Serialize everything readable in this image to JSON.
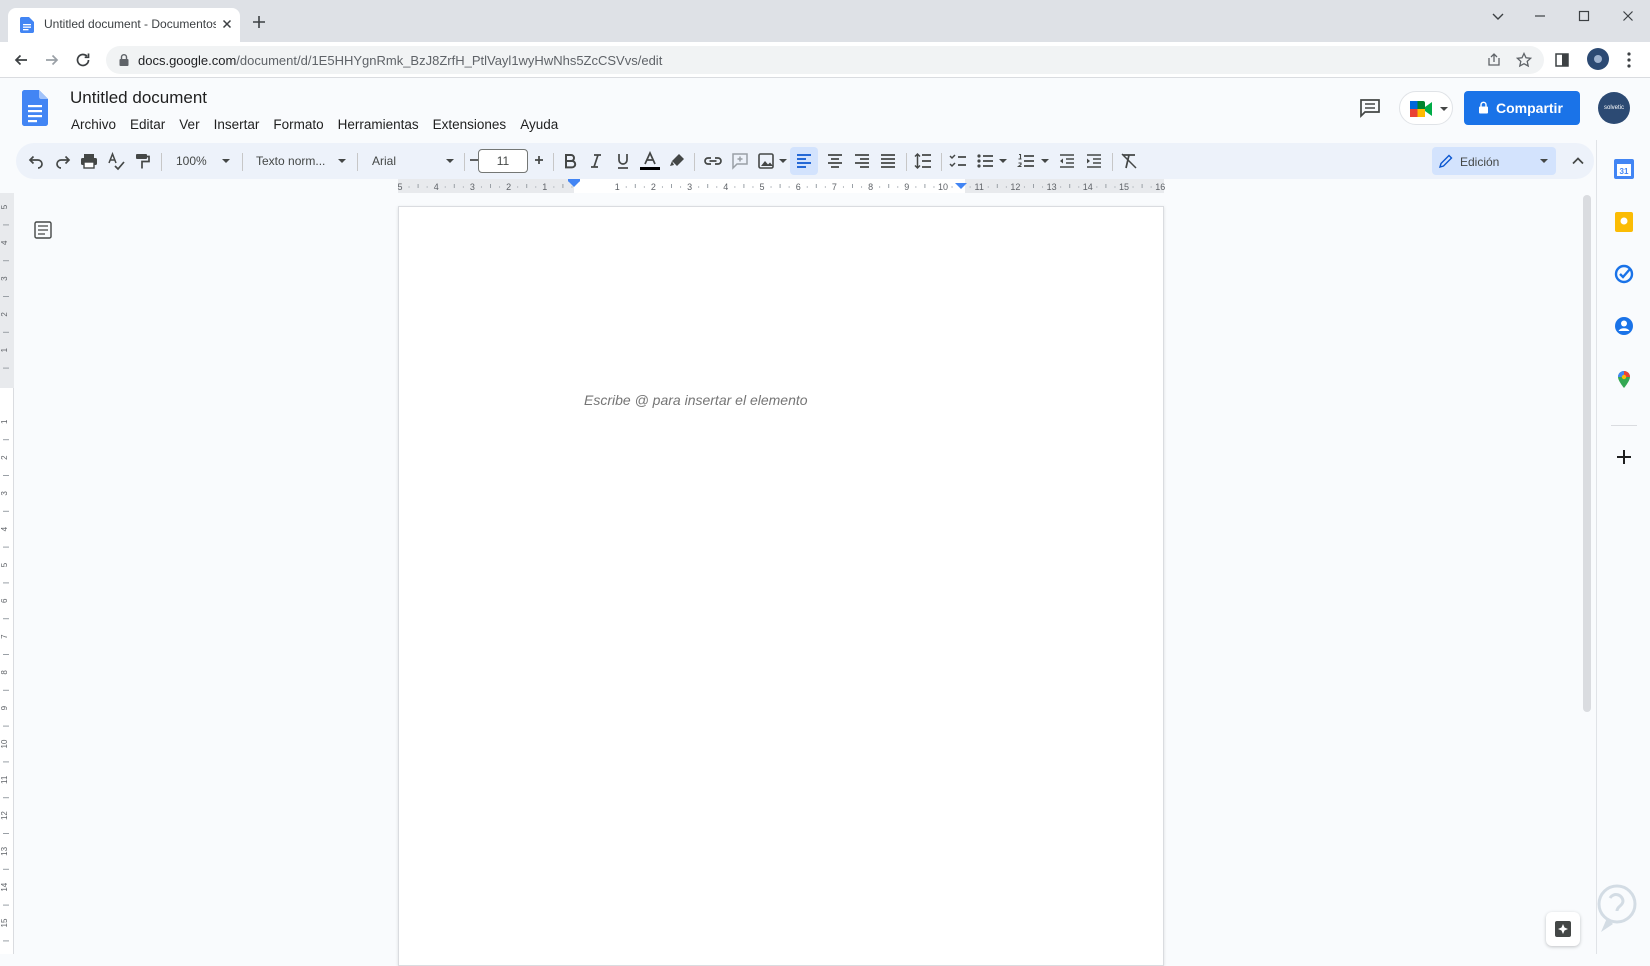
{
  "browser": {
    "tab_title": "Untitled document - Documentos",
    "url_host": "docs.google.com",
    "url_path": "/document/d/1E5HHYgnRmk_BzJ8ZrfH_PtlVayl1wyHwNhs5ZcCSVvs/edit"
  },
  "doc": {
    "title": "Untitled document",
    "menu": [
      "Archivo",
      "Editar",
      "Ver",
      "Insertar",
      "Formato",
      "Herramientas",
      "Extensiones",
      "Ayuda"
    ],
    "share_label": "Compartir",
    "avatar_text": "solvetic"
  },
  "toolbar": {
    "zoom": "100%",
    "style": "Texto norm...",
    "font": "Arial",
    "font_size": "11",
    "mode": "Edición"
  },
  "ruler": {
    "labels": [
      "5",
      "4",
      "3",
      "2",
      "1",
      "1",
      "1",
      "2",
      "3",
      "4",
      "5",
      "6",
      "7",
      "8",
      "9",
      "10",
      "11",
      "12",
      "13",
      "14",
      "15",
      "16"
    ],
    "vertical_labels": [
      "5",
      "4",
      "3",
      "2",
      "1",
      "1",
      "2",
      "3",
      "4",
      "5",
      "6",
      "7",
      "8",
      "9",
      "10",
      "11",
      "12",
      "13",
      "14",
      "15"
    ]
  },
  "page": {
    "placeholder": "Escribe @ para insertar el elemento"
  },
  "colors": {
    "accent": "#1a73e8",
    "toolbar_bg": "#edf2fa",
    "selected_bg": "#d3e3fd",
    "docs_blue": "#4285f4"
  },
  "side_panel_icons": [
    "calendar-icon",
    "keep-icon",
    "tasks-icon",
    "contacts-icon",
    "maps-icon",
    "add-icon"
  ]
}
